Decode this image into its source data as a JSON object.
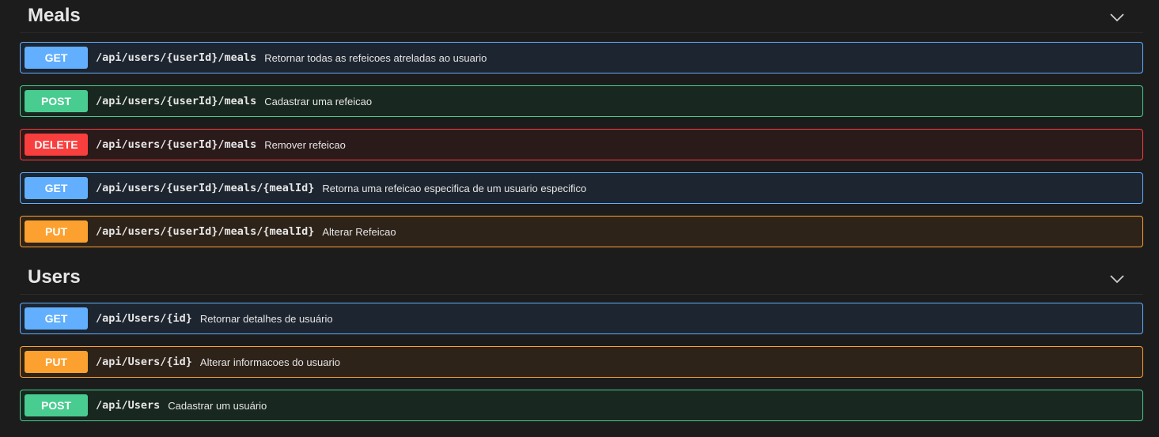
{
  "sections": [
    {
      "title": "Meals",
      "toggle_icon": "chevron-down-icon",
      "operations": [
        {
          "method": "GET",
          "path": "/api/users/{userId}/meals",
          "description": "Retornar todas as refeicoes atreladas ao usuario"
        },
        {
          "method": "POST",
          "path": "/api/users/{userId}/meals",
          "description": "Cadastrar uma refeicao"
        },
        {
          "method": "DELETE",
          "path": "/api/users/{userId}/meals",
          "description": "Remover refeicao"
        },
        {
          "method": "GET",
          "path": "/api/users/{userId}/meals/{mealId}",
          "description": "Retorna uma refeicao especifica de um usuario especifico"
        },
        {
          "method": "PUT",
          "path": "/api/users/{userId}/meals/{mealId}",
          "description": "Alterar Refeicao"
        }
      ]
    },
    {
      "title": "Users",
      "toggle_icon": "chevron-down-icon",
      "operations": [
        {
          "method": "GET",
          "path": "/api/Users/{id}",
          "description": "Retornar detalhes de usuário"
        },
        {
          "method": "PUT",
          "path": "/api/Users/{id}",
          "description": "Alterar informacoes do usuario"
        },
        {
          "method": "POST",
          "path": "/api/Users",
          "description": "Cadastrar um usuário"
        }
      ]
    }
  ],
  "colors": {
    "get": "#61affe",
    "post": "#49cc90",
    "delete": "#f93e3e",
    "put": "#fca130",
    "background": "#1c1c1c"
  }
}
